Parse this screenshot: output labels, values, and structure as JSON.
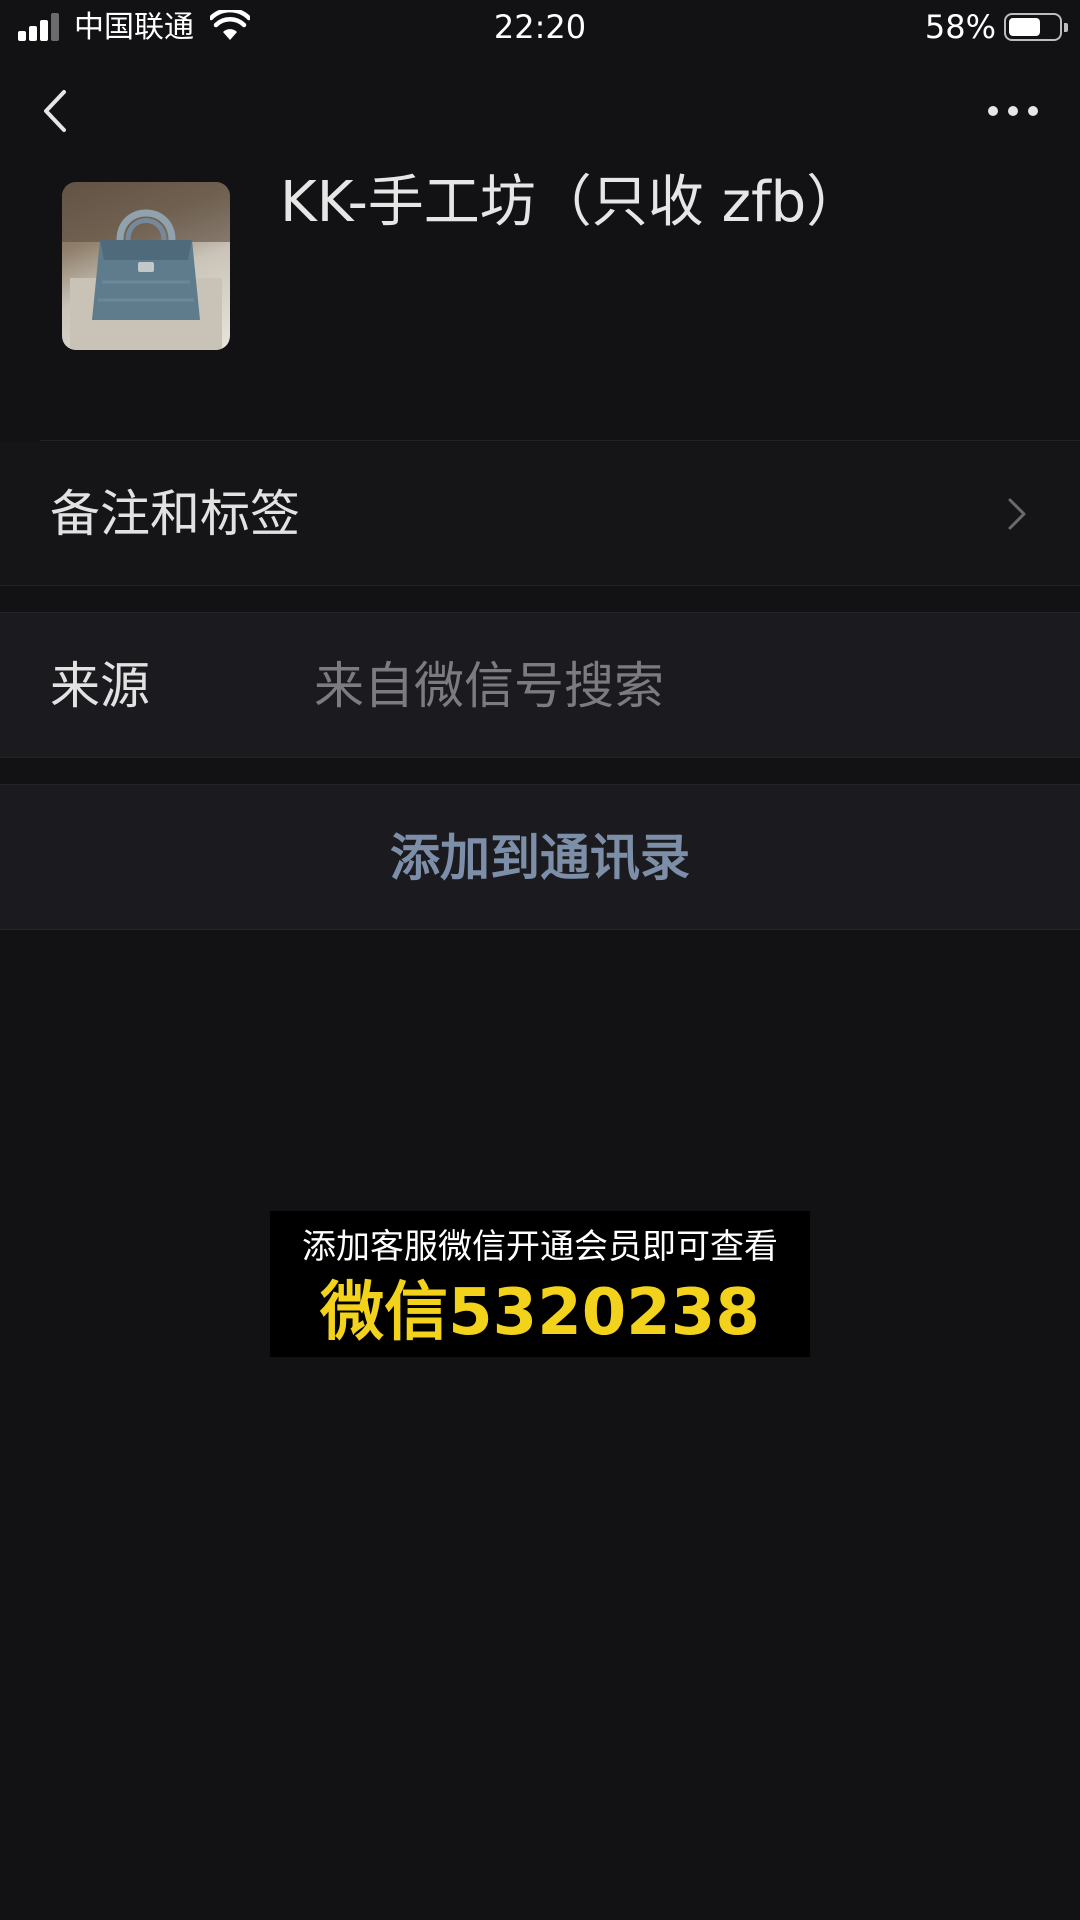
{
  "status_bar": {
    "carrier": "中国联通",
    "time": "22:20",
    "battery_percent": "58%",
    "battery_level": 0.58,
    "signal_bars": 3,
    "icons": [
      "signal-icon",
      "wifi-icon",
      "battery-icon"
    ]
  },
  "nav": {
    "back_icon": "chevron-left-icon",
    "more_icon": "more-horizontal-icon"
  },
  "profile": {
    "name": "KK-手工坊（只收 zfb）",
    "avatar": "handbag-photo"
  },
  "rows": {
    "remark_label": "备注和标签",
    "source_label": "来源",
    "source_value": "来自微信号搜索",
    "add_contact_label": "添加到通讯录"
  },
  "promo": {
    "line1": "添加客服微信开通会员即可查看",
    "line2": "微信5320238"
  },
  "colors": {
    "background": "#121114",
    "row_background": "#1b1a1e",
    "link": "#7d8fa8",
    "promo_highlight": "#f2d21b"
  }
}
